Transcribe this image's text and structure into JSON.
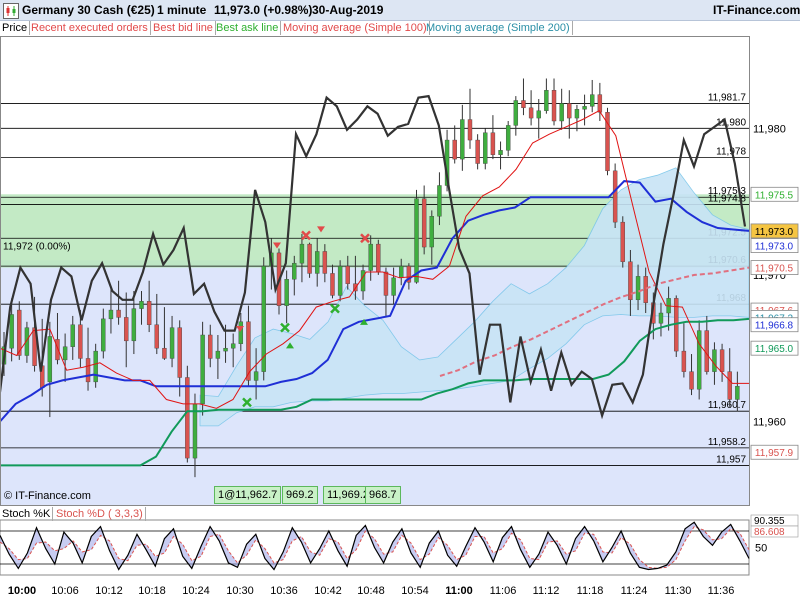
{
  "header": {
    "instrument": "Germany 30 Cash (€25)",
    "timeframe": "1 minute",
    "change": "11,973.0 (+0.98%)",
    "date": "30-Aug-2019",
    "site": "IT-Finance.com"
  },
  "legend": {
    "items": [
      {
        "label": "Price",
        "color": "#000000"
      },
      {
        "label": "Recent executed orders",
        "color": "#e24a4a"
      },
      {
        "label": "Best bid line",
        "color": "#e24a4a"
      },
      {
        "label": "Best ask line",
        "color": "#2fb02f"
      },
      {
        "label": "Moving average (Simple 100)",
        "color": "#e24a4a"
      },
      {
        "label": "Moving average (Simple 200)",
        "color": "#2a8fa6"
      }
    ]
  },
  "overlay": {
    "ref_label": "11,972 (0.00%)",
    "copyright": "© IT-Finance.com",
    "tooltips": [
      "1@11,962.7",
      "969.2",
      "11,969.2",
      "968.7"
    ]
  },
  "stoch_legend": {
    "k": "Stoch %K",
    "d": "Stoch %D ( 3,3,3)"
  },
  "colors": {
    "up": "#3fae3f",
    "down": "#d9534f",
    "wick": "#333333",
    "price_line": "#333333",
    "blue_line": "#1f2fd6",
    "green_line": "#119a5a",
    "red_line": "#e01414",
    "ma200": "#e07080",
    "cloud": "#c8e4f6",
    "band": "#b9e6bb"
  },
  "chart_data": {
    "type": "candlestick",
    "title": "Germany 30 Cash (€25)",
    "timeframe": "1 minute",
    "x_ticks": [
      "10:00",
      "10:06",
      "10:12",
      "10:18",
      "10:24",
      "10:30",
      "10:36",
      "10:42",
      "10:48",
      "10:54",
      "11:00",
      "11:06",
      "11:12",
      "11:18",
      "11:24",
      "11:30",
      "11:36"
    ],
    "y_ticks": [
      11960,
      11970,
      11980
    ],
    "ylim": [
      11954.3,
      11986.3
    ],
    "last_price": 11973.0,
    "ref_price": 11972,
    "horizontal_levels": [
      {
        "label": "11,981.7",
        "value": 11981.7
      },
      {
        "label": "11,980",
        "value": 11980.0
      },
      {
        "label": "11,978",
        "value": 11978.0
      },
      {
        "label": "11,975.3",
        "value": 11975.3
      },
      {
        "label": "11,974.8",
        "value": 11974.8
      },
      {
        "label": "11,972.5",
        "value": 11972.5
      },
      {
        "label": "11,970.6",
        "value": 11970.6
      },
      {
        "label": "11,968",
        "value": 11968.0
      },
      {
        "label": "11,960.7",
        "value": 11960.7
      },
      {
        "label": "11,958.2",
        "value": 11958.2
      },
      {
        "label": "11,957",
        "value": 11957.0
      }
    ],
    "right_labels": [
      {
        "text": "11,975.5",
        "value": 11975.5,
        "color": "#2fb02f",
        "bg": "#ffffff"
      },
      {
        "text": "11,973.0",
        "value": 11973.0,
        "color": "#000000",
        "bg": "#f5c542"
      },
      {
        "text": "11,973.0",
        "value": 11972.0,
        "color": "#1f2fd6",
        "bg": "#ffffff"
      },
      {
        "text": "11,970.5",
        "value": 11970.5,
        "color": "#d9534f",
        "bg": "#ffffff"
      },
      {
        "text": "11,967.6",
        "value": 11967.6,
        "color": "#d9534f",
        "bg": "#ffffff"
      },
      {
        "text": "11,967.2",
        "value": 11967.1,
        "color": "#2a8fa6",
        "bg": "#ffffff"
      },
      {
        "text": "11,966.8",
        "value": 11966.6,
        "color": "#1f2fd6",
        "bg": "#ffffff"
      },
      {
        "text": "11,965.0",
        "value": 11965.0,
        "color": "#119a5a",
        "bg": "#ffffff"
      },
      {
        "text": "11,957.9",
        "value": 11957.9,
        "color": "#d9534f",
        "bg": "#ffffff"
      }
    ],
    "candles": [
      [
        11963.9,
        11966.1,
        11963.1,
        11965.1
      ],
      [
        11965.0,
        11968.4,
        11964.1,
        11967.3
      ],
      [
        11967.6,
        11968.2,
        11964.2,
        11964.5
      ],
      [
        11964.5,
        11966.8,
        11964.0,
        11966.4
      ],
      [
        11966.4,
        11968.5,
        11963.4,
        11963.8
      ],
      [
        11963.8,
        11967.0,
        11961.7,
        11962.3
      ],
      [
        11962.7,
        11966.8,
        11960.3,
        11965.8
      ],
      [
        11965.6,
        11967.4,
        11963.9,
        11964.2
      ],
      [
        11964.2,
        11966.0,
        11962.7,
        11965.1
      ],
      [
        11965.1,
        11967.2,
        11964.2,
        11966.6
      ],
      [
        11966.6,
        11967.6,
        11963.7,
        11964.3
      ],
      [
        11964.3,
        11966.4,
        11962.1,
        11962.7
      ],
      [
        11962.7,
        11965.3,
        11962.3,
        11964.8
      ],
      [
        11964.8,
        11967.7,
        11964.3,
        11967.0
      ],
      [
        11967.0,
        11969.2,
        11966.0,
        11967.6
      ],
      [
        11967.6,
        11969.6,
        11966.6,
        11967.1
      ],
      [
        11967.1,
        11968.8,
        11963.7,
        11965.5
      ],
      [
        11965.5,
        11968.9,
        11964.6,
        11967.7
      ],
      [
        11967.7,
        11968.9,
        11966.6,
        11968.2
      ],
      [
        11968.2,
        11969.6,
        11966.1,
        11966.6
      ],
      [
        11966.6,
        11968.7,
        11964.6,
        11965.0
      ],
      [
        11965.0,
        11967.8,
        11964.2,
        11964.3
      ],
      [
        11964.3,
        11967.2,
        11963.7,
        11966.4
      ],
      [
        11966.4,
        11966.9,
        11961.7,
        11963.0
      ],
      [
        11963.0,
        11963.8,
        11957.2,
        11957.5
      ],
      [
        11957.5,
        11961.9,
        11956.2,
        11961.2
      ],
      [
        11961.2,
        11966.8,
        11960.4,
        11965.9
      ],
      [
        11965.9,
        11966.6,
        11963.7,
        11964.3
      ],
      [
        11964.3,
        11965.9,
        11962.9,
        11964.8
      ],
      [
        11964.8,
        11966.6,
        11964.0,
        11965.0
      ],
      [
        11965.0,
        11966.0,
        11963.7,
        11965.3
      ],
      [
        11965.3,
        11967.4,
        11964.8,
        11966.8
      ],
      [
        11966.8,
        11967.9,
        11962.4,
        11962.8
      ],
      [
        11962.8,
        11965.0,
        11961.5,
        11963.4
      ],
      [
        11963.4,
        11971.2,
        11962.8,
        11970.6
      ],
      [
        11970.6,
        11972.5,
        11969.0,
        11971.5
      ],
      [
        11971.5,
        11971.8,
        11967.3,
        11967.9
      ],
      [
        11967.9,
        11970.3,
        11966.7,
        11969.7
      ],
      [
        11969.7,
        11971.3,
        11968.6,
        11970.8
      ],
      [
        11970.8,
        11972.8,
        11969.5,
        11972.1
      ],
      [
        11972.1,
        11972.2,
        11969.8,
        11970.1
      ],
      [
        11970.1,
        11972.5,
        11969.2,
        11971.6
      ],
      [
        11971.6,
        11972.1,
        11969.5,
        11970.1
      ],
      [
        11970.1,
        11970.7,
        11968.4,
        11968.6
      ],
      [
        11968.6,
        11971.0,
        11968.2,
        11970.6
      ],
      [
        11970.6,
        11971.3,
        11969.0,
        11969.4
      ],
      [
        11969.4,
        11971.3,
        11968.3,
        11968.9
      ],
      [
        11968.9,
        11970.7,
        11968.3,
        11970.3
      ],
      [
        11970.3,
        11972.7,
        11969.6,
        11972.1
      ],
      [
        11972.1,
        11972.4,
        11970.0,
        11970.2
      ],
      [
        11970.2,
        11970.5,
        11967.2,
        11968.6
      ],
      [
        11968.6,
        11970.5,
        11968.0,
        11969.8
      ],
      [
        11969.8,
        11971.1,
        11969.3,
        11970.6
      ],
      [
        11970.6,
        11970.8,
        11969.0,
        11969.5
      ],
      [
        11969.5,
        11975.8,
        11969.4,
        11975.2
      ],
      [
        11975.2,
        11976.1,
        11971.4,
        11971.9
      ],
      [
        11971.9,
        11974.4,
        11970.7,
        11974.0
      ],
      [
        11974.0,
        11977.0,
        11973.4,
        11976.1
      ],
      [
        11976.1,
        11979.9,
        11975.7,
        11979.2
      ],
      [
        11979.2,
        11980.2,
        11977.6,
        11977.9
      ],
      [
        11977.9,
        11981.6,
        11977.1,
        11980.6
      ],
      [
        11980.6,
        11982.7,
        11978.6,
        11979.2
      ],
      [
        11979.2,
        11979.6,
        11977.2,
        11977.6
      ],
      [
        11977.6,
        11980.0,
        11977.2,
        11979.7
      ],
      [
        11979.7,
        11980.9,
        11977.9,
        11978.2
      ],
      [
        11978.2,
        11979.1,
        11977.2,
        11978.5
      ],
      [
        11978.5,
        11980.5,
        11978.1,
        11980.2
      ],
      [
        11980.2,
        11982.2,
        11979.5,
        11981.9
      ],
      [
        11981.9,
        11983.4,
        11980.9,
        11981.4
      ],
      [
        11981.4,
        11982.6,
        11980.2,
        11980.7
      ],
      [
        11980.7,
        11982.0,
        11979.3,
        11981.2
      ],
      [
        11981.2,
        11983.4,
        11981.0,
        11982.6
      ],
      [
        11982.6,
        11983.4,
        11980.2,
        11980.5
      ],
      [
        11980.5,
        11982.7,
        11979.9,
        11981.7
      ],
      [
        11981.7,
        11982.6,
        11979.3,
        11980.7
      ],
      [
        11980.7,
        11981.6,
        11979.8,
        11981.3
      ],
      [
        11981.3,
        11982.3,
        11980.2,
        11981.5
      ],
      [
        11981.5,
        11983.3,
        11981.1,
        11982.3
      ],
      [
        11982.3,
        11983.1,
        11980.5,
        11981.1
      ],
      [
        11981.1,
        11981.4,
        11976.8,
        11977.1
      ],
      [
        11977.1,
        11977.6,
        11973.2,
        11973.6
      ],
      [
        11973.6,
        11974.0,
        11970.5,
        11970.9
      ],
      [
        11970.9,
        11971.7,
        11967.2,
        11968.3
      ],
      [
        11968.3,
        11970.7,
        11967.6,
        11969.9
      ],
      [
        11969.9,
        11970.5,
        11967.4,
        11968.1
      ],
      [
        11968.1,
        11968.8,
        11965.6,
        11966.7
      ],
      [
        11966.7,
        11968.1,
        11965.8,
        11967.4
      ],
      [
        11967.4,
        11969.2,
        11966.2,
        11968.4
      ],
      [
        11968.4,
        11968.6,
        11964.4,
        11964.8
      ],
      [
        11964.8,
        11966.7,
        11963.0,
        11963.4
      ],
      [
        11963.4,
        11964.6,
        11961.8,
        11962.2
      ],
      [
        11962.2,
        11966.9,
        11961.5,
        11966.2
      ],
      [
        11966.2,
        11967.2,
        11963.2,
        11963.4
      ],
      [
        11963.4,
        11965.4,
        11962.5,
        11964.9
      ],
      [
        11964.9,
        11965.3,
        11962.7,
        11963.4
      ],
      [
        11963.4,
        11965.0,
        11961.0,
        11961.5
      ],
      [
        11961.5,
        11963.4,
        11960.7,
        11962.4
      ]
    ],
    "price_line": [
      11962.0,
      11967.8,
      11970.5,
      11969.4,
      11963.4,
      11968.3,
      11970.5,
      11969.9,
      11966.9,
      11969.6,
      11970.8,
      11968.9,
      11968.3,
      11968.3,
      11970.2,
      11972.8,
      11970.7,
      11971.7,
      11973.2,
      11968.7,
      11969.4,
      11967.5,
      11966.2,
      11966.2,
      11968.8,
      11975.8,
      11973.6,
      11969.0,
      11970.8,
      11979.6,
      11978.1,
      11979.6,
      11982.1,
      11981.5,
      11979.9,
      11980.6,
      11981.5,
      11981.0,
      11979.5,
      11980.1,
      11980.3,
      11982.1,
      11982.2,
      11980.2,
      11975.9,
      11971.8,
      11970.1,
      11963.2,
      11966.6,
      11966.6,
      11961.3,
      11965.8,
      11962.7,
      11964.9,
      11962.1,
      11964.7,
      11962.5,
      11963.4,
      11962.9,
      11960.4,
      11962.5,
      11962.6,
      11961.3,
      11963.2,
      11967.9,
      11972.1,
      11975.5,
      11979.2,
      11977.4,
      11979.6,
      11980.1,
      11980.6,
      11977.6,
      11973.3
    ],
    "blue_line": [
      11960.0,
      11961.2,
      11961.8,
      11962.5,
      11962.8,
      11963.0,
      11963.2,
      11963.0,
      11962.8,
      11962.8,
      11962.4,
      11962.4,
      11962.4,
      11962.4,
      11962.4,
      11962.4,
      11962.4,
      11962.4,
      11962.7,
      11962.9,
      11963.3,
      11964.2,
      11966.3,
      11966.8,
      11967.0,
      11967.2,
      11969.6,
      11970.3,
      11970.5,
      11972.5,
      11973.7,
      11974.1,
      11974.4,
      11974.6,
      11975.3,
      11975.3,
      11975.3,
      11975.3,
      11975.3,
      11975.3,
      11976.4,
      11976.3,
      11975.0,
      11975.2,
      11974.3,
      11973.6,
      11973.2,
      11973.1,
      11973.0
    ],
    "green_line": [
      11957.0,
      11957.0,
      11957.0,
      11957.0,
      11957.0,
      11957.0,
      11957.0,
      11957.0,
      11957.0,
      11957.0,
      11957.6,
      11959.3,
      11960.7,
      11960.7,
      11960.8,
      11960.8,
      11960.8,
      11960.8,
      11960.8,
      11961.0,
      11961.5,
      11961.5,
      11961.5,
      11961.5,
      11961.5,
      11961.5,
      11961.5,
      11961.5,
      11961.9,
      11962.2,
      11962.6,
      11962.8,
      11962.8,
      11962.8,
      11962.9,
      11962.9,
      11962.9,
      11962.9,
      11962.9,
      11963.2,
      11964.1,
      11965.5,
      11966.3,
      11966.6,
      11966.8,
      11966.8,
      11966.9,
      11966.9,
      11967.0
    ],
    "red_line": [
      11965.0,
      11964.5,
      11966.2,
      11966.3,
      11963.5,
      11963.7,
      11964.0,
      11963.3,
      11962.8,
      11962.8,
      11961.5,
      11961.2,
      11961.2,
      11960.9,
      11961.5,
      11963.4,
      11964.6,
      11965.3,
      11966.2,
      11967.8,
      11968.2,
      11968.5,
      11970.2,
      11970.2,
      11969.8,
      11969.9,
      11969.7,
      11970.6,
      11974.0,
      11975.4,
      11976.0,
      11977.2,
      11979.0,
      11979.6,
      11980.1,
      11980.6,
      11981.2,
      11979.5,
      11974.8,
      11970.2,
      11967.9,
      11967.8,
      11965.3,
      11963.8,
      11962.6,
      11962.6
    ],
    "ma200": [
      11963.1,
      11963.5,
      11964.1,
      11964.5,
      11965.1,
      11965.6,
      11966.2,
      11966.8,
      11967.4,
      11968.0,
      11968.5,
      11968.9,
      11969.4,
      11969.7,
      11970.0,
      11970.1,
      11970.3,
      11970.5
    ],
    "stoch": {
      "ylim": [
        0,
        100
      ],
      "y_ticks": [
        50
      ],
      "labels": [
        {
          "text": "90.355",
          "value": 90.355,
          "color": "#000000"
        },
        {
          "text": "86.608",
          "value": 86.608,
          "color": "#d9534f"
        }
      ],
      "k": [
        72,
        38,
        12,
        40,
        86,
        48,
        20,
        78,
        58,
        22,
        70,
        88,
        44,
        10,
        36,
        74,
        46,
        16,
        66,
        84,
        34,
        12,
        52,
        88,
        62,
        22,
        14,
        56,
        74,
        30,
        10,
        42,
        86,
        60,
        22,
        48,
        80,
        44,
        16,
        72,
        90,
        50,
        22,
        60,
        84,
        40,
        14,
        58,
        80,
        36,
        16,
        52,
        86,
        60,
        24,
        68,
        88,
        46,
        14,
        38,
        78,
        54,
        20,
        66,
        88,
        62,
        24,
        50,
        80,
        40,
        14,
        10,
        12,
        18,
        42,
        84,
        96,
        70,
        54,
        78,
        92,
        62,
        30
      ],
      "d": [
        60,
        48,
        28,
        30,
        58,
        60,
        44,
        48,
        62,
        42,
        46,
        72,
        62,
        30,
        26,
        54,
        56,
        34,
        40,
        70,
        56,
        26,
        34,
        70,
        74,
        44,
        22,
        36,
        64,
        48,
        22,
        28,
        62,
        70,
        42,
        36,
        66,
        60,
        30,
        46,
        80,
        66,
        38,
        42,
        72,
        58,
        28,
        38,
        68,
        54,
        28,
        36,
        70,
        70,
        40,
        48,
        76,
        64,
        30,
        28,
        60,
        62,
        38,
        44,
        76,
        74,
        42,
        40,
        68,
        56,
        28,
        14,
        12,
        14,
        28,
        62,
        88,
        82,
        64,
        66,
        84,
        76,
        46
      ]
    }
  },
  "ui_texts": {
    "x_ticks": [
      "10:00",
      "10:06",
      "10:12",
      "10:18",
      "10:24",
      "10:30",
      "10:36",
      "10:42",
      "10:48",
      "10:54",
      "11:00",
      "11:06",
      "11:12",
      "11:18",
      "11:24",
      "11:30",
      "11:36"
    ],
    "y_ticks": [
      "11,960",
      "11,970",
      "11,980"
    ],
    "stoch_mid": "50"
  }
}
